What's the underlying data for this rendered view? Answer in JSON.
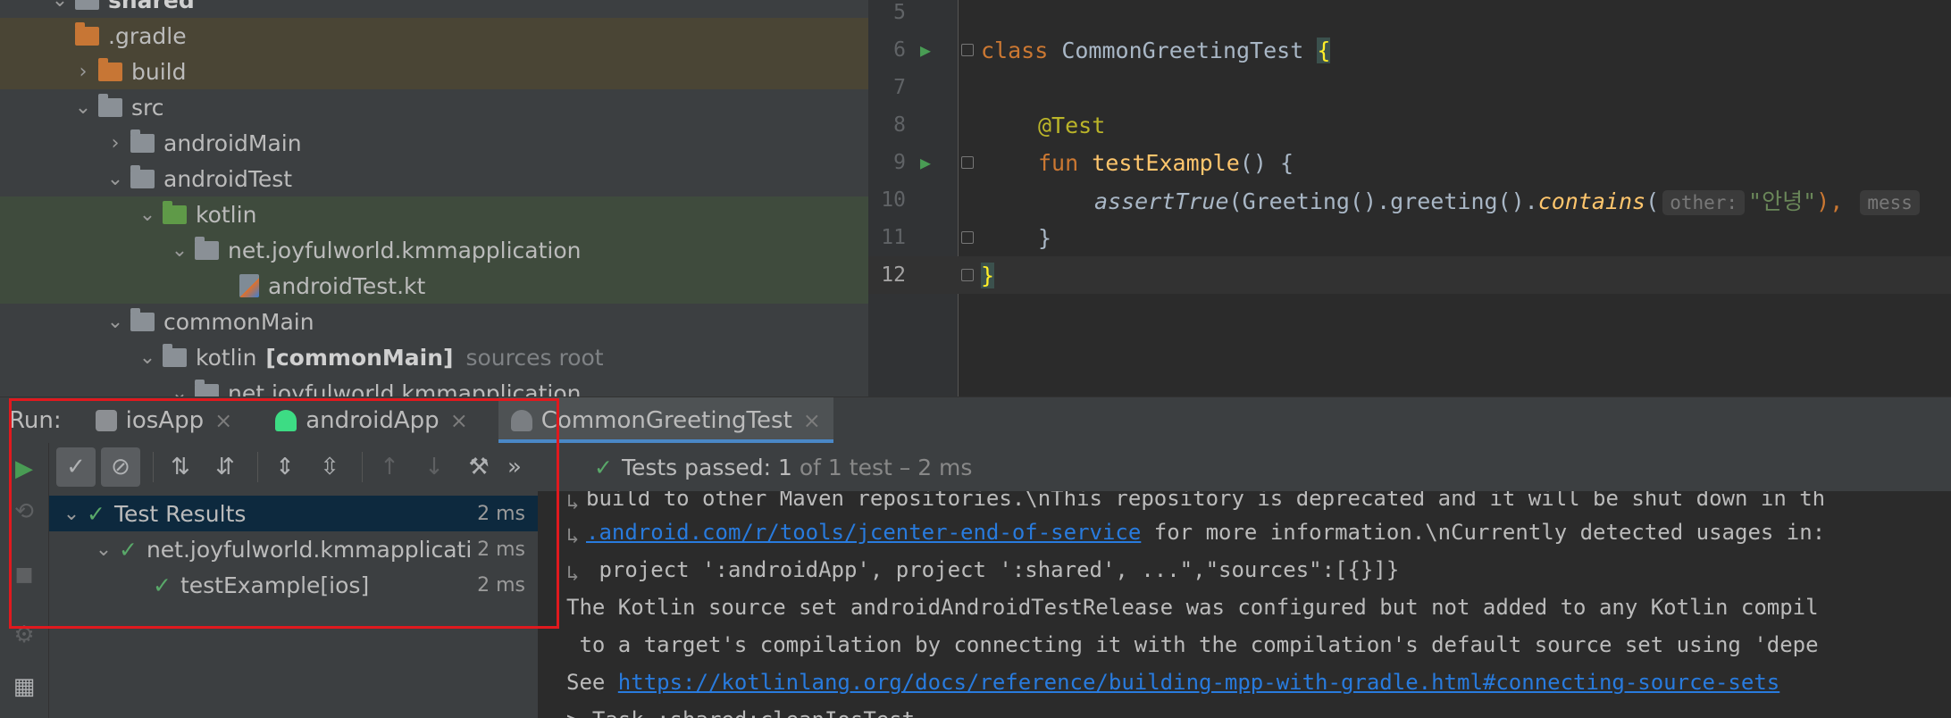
{
  "tree": {
    "items": [
      {
        "label": "shared"
      },
      {
        "label": ".gradle"
      },
      {
        "label": "build"
      },
      {
        "label": "src"
      },
      {
        "label": "androidMain"
      },
      {
        "label": "androidTest"
      },
      {
        "label": "kotlin"
      },
      {
        "label": "net.joyfulworld.kmmapplication"
      },
      {
        "label": "androidTest.kt"
      },
      {
        "label": "commonMain"
      },
      {
        "label": "kotlin",
        "bold": "[commonMain]",
        "suffix": "sources root"
      },
      {
        "label": "net.joyfulworld.kmmapplication"
      }
    ]
  },
  "editor": {
    "line_numbers": [
      "5",
      "6",
      "7",
      "8",
      "9",
      "10",
      "11",
      "12"
    ],
    "line6": {
      "kw": "class",
      "name": "CommonGreetingTest",
      "brace": "{"
    },
    "line8": {
      "annotation": "@Test"
    },
    "line9": {
      "kw": "fun",
      "name": "testExample",
      "rest": "() {"
    },
    "line10": {
      "fn": "assertTrue",
      "mid": "(Greeting().greeting().",
      "fn2": "contains",
      "open": "(",
      "hint1": "other:",
      "str": "\"안녕\"",
      "close": "),",
      "hint2": "mess"
    },
    "line11": {
      "text": "}"
    },
    "line12": {
      "text": "}"
    }
  },
  "run": {
    "label": "Run:",
    "tabs": [
      {
        "label": "iosApp",
        "color": "#8c8f93"
      },
      {
        "label": "androidApp",
        "color": "#3ddc84"
      },
      {
        "label": "CommonGreetingTest",
        "color": "#7a7e82"
      }
    ],
    "summary": {
      "prefix": "Tests passed:",
      "count": "1",
      "rest": "of 1 test – 2 ms"
    }
  },
  "results": {
    "rows": [
      {
        "label": "Test Results",
        "time": "2 ms"
      },
      {
        "label": "net.joyfulworld.kmmapplicati",
        "time": "2 ms"
      },
      {
        "label": "testExample[ios]",
        "time": "2 ms"
      }
    ]
  },
  "console": {
    "line1": "build to other Maven repositories.\\nThis repository is deprecated and it will be shut down in th",
    "line2_link": ".android.com/r/tools/jcenter-end-of-service",
    "line2_rest": " for more information.\\nCurrently detected usages in:",
    "line3": " project ':androidApp', project ':shared', ...\",\"sources\":[{}]}",
    "line4": "The Kotlin source set androidAndroidTestRelease was configured but not added to any Kotlin compil",
    "line5": " to a target's compilation by connecting it with the compilation's default source set using 'depe",
    "line6_prefix": "See ",
    "line6_link": "https://kotlinlang.org/docs/reference/building-mpp-with-gradle.html#connecting-source-sets",
    "line7": "> Task :shared:cleanIosTest"
  },
  "colors": {
    "accent": "#4a88c7",
    "pass": "#59a869",
    "highlight": "#e0191e"
  }
}
